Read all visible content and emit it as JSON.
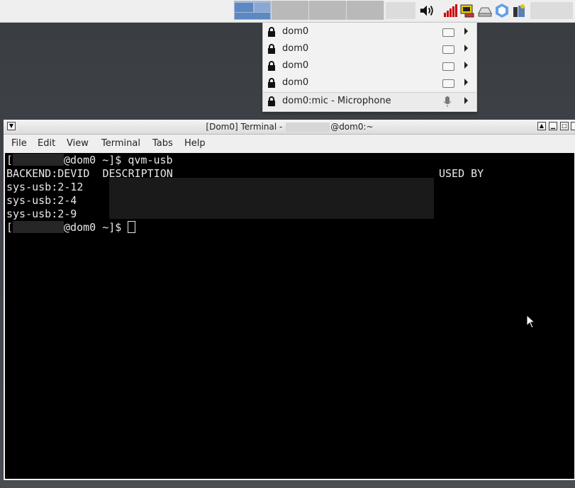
{
  "panel": {
    "workspaces": [
      "workspace-1",
      "workspace-2",
      "workspace-3",
      "workspace-4"
    ],
    "tray_icons": [
      "volume-icon",
      "network-signal-icon",
      "qubes-domains-icon",
      "disk-icon",
      "qubes-updates-icon",
      "devices-icon"
    ]
  },
  "devices_menu": {
    "items": [
      {
        "label": "dom0",
        "icon": "lock-icon",
        "device_icon": "drive-icon"
      },
      {
        "label": "dom0",
        "icon": "lock-icon",
        "device_icon": "drive-icon"
      },
      {
        "label": "dom0",
        "icon": "lock-icon",
        "device_icon": "drive-icon"
      },
      {
        "label": "dom0",
        "icon": "lock-icon",
        "device_icon": "drive-icon"
      }
    ],
    "mic": {
      "label": "dom0:mic - Microphone",
      "icon": "lock-icon",
      "device_icon": "microphone-icon"
    }
  },
  "terminal_window": {
    "title_prefix": "[Dom0] Terminal - ",
    "title_suffix": "@dom0:~",
    "menus": [
      "File",
      "Edit",
      "View",
      "Terminal",
      "Tabs",
      "Help"
    ],
    "lines": {
      "cmd1_open": "[",
      "cmd1_rest": "@dom0 ~]$ qvm-usb",
      "header_left": "BACKEND:DEVID  DESCRIPTION",
      "header_right": "USED BY",
      "row1": "sys-usb:2-12",
      "row2": "sys-usb:2-4",
      "row3": "sys-usb:2-9",
      "cmd2_open": "[",
      "cmd2_rest": "@dom0 ~]$ "
    }
  }
}
